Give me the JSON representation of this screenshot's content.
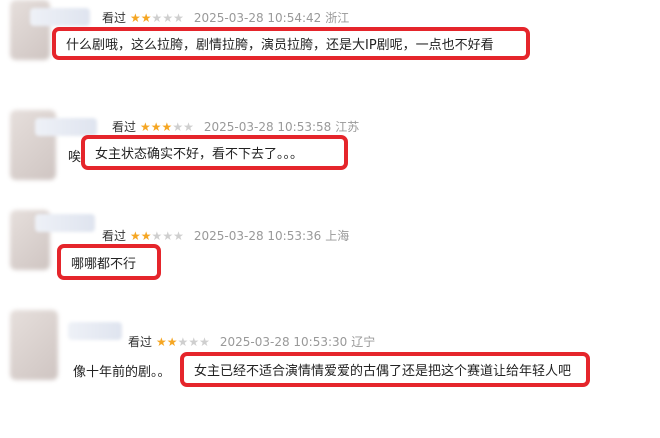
{
  "reviews": [
    {
      "status": "看过",
      "rating": 2,
      "time": "2025-03-28 10:54:42",
      "location": "浙江",
      "comment": "什么剧哦，这么拉胯，剧情拉胯，演员拉胯，还是大IP剧呢，一点也不好看",
      "prefix": ""
    },
    {
      "status": "看过",
      "rating": 3,
      "time": "2025-03-28 10:53:58",
      "location": "江苏",
      "comment": "女主状态确实不好，看不下去了。。。",
      "prefix": "唉"
    },
    {
      "status": "看过",
      "rating": 2,
      "time": "2025-03-28 10:53:36",
      "location": "上海",
      "comment": "哪哪都不行",
      "prefix": ""
    },
    {
      "status": "看过",
      "rating": 2,
      "time": "2025-03-28 10:53:30",
      "location": "辽宁",
      "comment": "女主已经不适合演情情爱爱的古偶了还是把这个赛道让给年轻人吧",
      "prefix": "像十年前的剧。。"
    }
  ],
  "colors": {
    "highlight": "#e5252b",
    "star": "#f5a623",
    "star_empty": "#cfcfcf"
  }
}
